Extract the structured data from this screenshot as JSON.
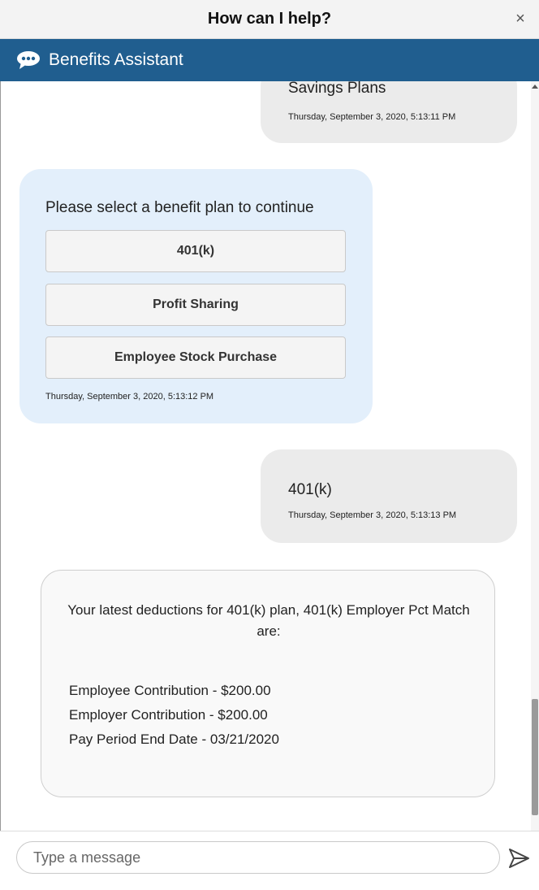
{
  "window": {
    "title": "How can I help?",
    "close_label": "×"
  },
  "header": {
    "name": "Benefits Assistant",
    "icon": "chat-bubble-icon"
  },
  "messages": {
    "m1": {
      "text": "Savings Plans",
      "timestamp": "Thursday, September 3, 2020, 5:13:11 PM"
    },
    "m2": {
      "prompt": "Please select a benefit plan to continue",
      "options": [
        "401(k)",
        "Profit Sharing",
        "Employee Stock Purchase"
      ],
      "timestamp": "Thursday, September 3, 2020, 5:13:12 PM"
    },
    "m3": {
      "text": "401(k)",
      "timestamp": "Thursday, September 3, 2020, 5:13:13 PM"
    },
    "m4": {
      "intro": "Your latest deductions for 401(k) plan, 401(k) Employer Pct Match are:",
      "lines": [
        "Employee Contribution - $200.00",
        "Employer Contribution - $200.00",
        "Pay Period End Date - 03/21/2020"
      ]
    }
  },
  "composer": {
    "placeholder": "Type a message",
    "send_icon": "send-icon"
  },
  "colors": {
    "header_bg": "#205e8f",
    "bot_bubble": "#e3effb",
    "user_bubble": "#ebebeb"
  }
}
